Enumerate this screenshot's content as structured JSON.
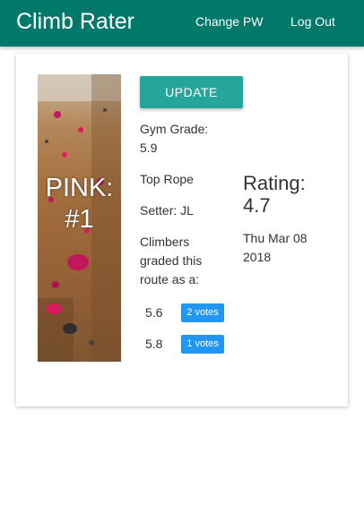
{
  "navbar": {
    "brand": "Climb Rater",
    "links": {
      "change_pw": "Change PW",
      "log_out": "Log Out"
    },
    "color": "#00796b"
  },
  "route": {
    "name": "PINK: #1",
    "update_label": "UPDATE",
    "gym_grade_label": "Gym Grade:",
    "gym_grade": "5.9",
    "type": "Top Rope",
    "setter": "Setter: JL",
    "climbers_label": "Climbers graded this route as a:",
    "votes": [
      {
        "grade": "5.6",
        "count": "2 votes"
      },
      {
        "grade": "5.8",
        "count": "1 votes"
      }
    ],
    "rating_label": "Rating:",
    "rating": "4.7",
    "date": "Thu Mar 08 2018"
  },
  "colors": {
    "button": "#26a69a",
    "badge": "#2196f3"
  }
}
